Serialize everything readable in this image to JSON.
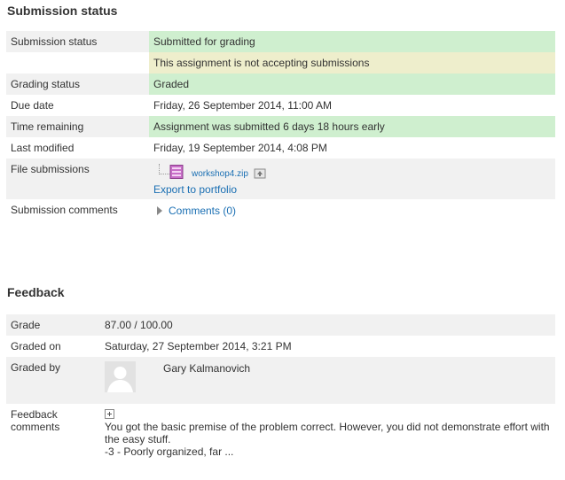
{
  "submission": {
    "title": "Submission status",
    "rows": {
      "status_label": "Submission status",
      "status_value": "Submitted for grading",
      "locked_message": "This assignment is not accepting submissions",
      "grading_label": "Grading status",
      "grading_value": "Graded",
      "due_label": "Due date",
      "due_value": "Friday, 26 September 2014, 11:00 AM",
      "remaining_label": "Time remaining",
      "remaining_value": "Assignment was submitted 6 days 18 hours early",
      "modified_label": "Last modified",
      "modified_value": "Friday, 19 September 2014, 4:08 PM",
      "files_label": "File submissions",
      "file_name": "workshop4.zip",
      "export_label": "Export to portfolio",
      "comments_label": "Submission comments",
      "comments_link": "Comments (0)"
    }
  },
  "feedback": {
    "title": "Feedback",
    "grade_label": "Grade",
    "grade_value": "87.00 / 100.00",
    "graded_on_label": "Graded on",
    "graded_on_value": "Saturday, 27 September 2014, 3:21 PM",
    "graded_by_label": "Graded by",
    "grader_name": "Gary Kalmanovich",
    "comments_label_1": "Feedback",
    "comments_label_2": "comments",
    "comment_text_1": "You got the basic premise of the problem correct. However, you did not demonstrate effort with the easy stuff.",
    "comment_text_2": "-3 - Poorly organized, far ..."
  },
  "colors": {
    "success": "#cfefcf",
    "warning": "#eeeecc",
    "link": "#1a6fb3",
    "row_alt": "#f1f1f1"
  },
  "icons": {
    "file": "zip-archive-icon",
    "portfolio": "portfolio-export-icon",
    "toggle": "expand-triangle-icon",
    "expand": "plus-box-icon",
    "avatar": "default-user-avatar"
  }
}
